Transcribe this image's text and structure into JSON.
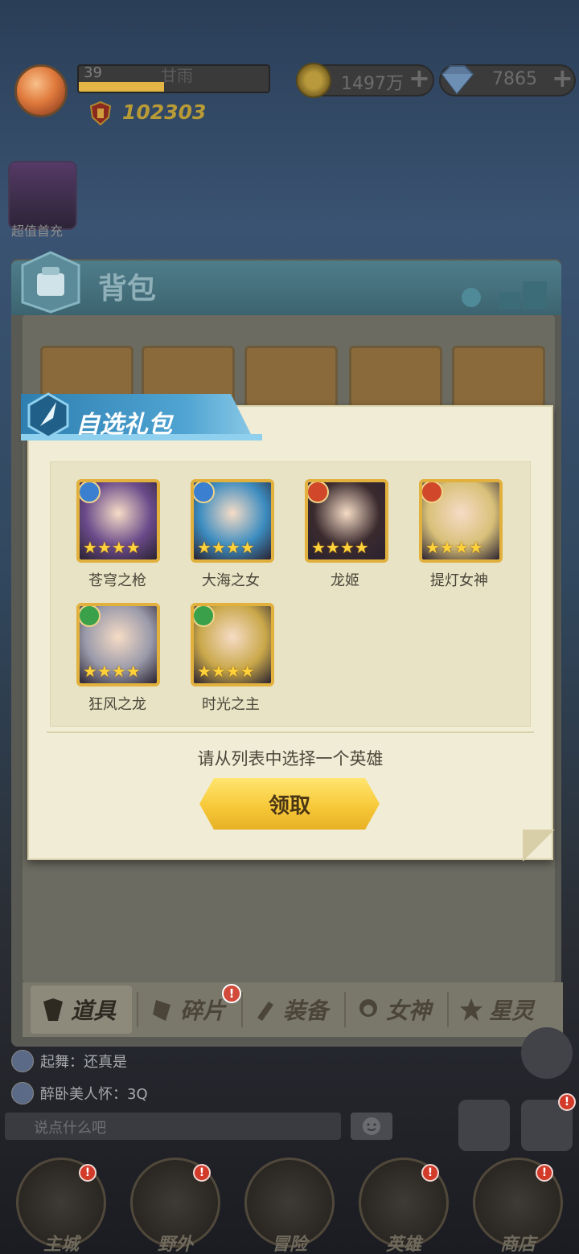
{
  "hud": {
    "level": "39",
    "player_name": "甘雨",
    "level_progress": 0.45,
    "power": "102303",
    "gold": "1497万",
    "gems": "7865",
    "plus": "+",
    "first_pay_label": "超值首充"
  },
  "backpack": {
    "title": "背包",
    "tabs": [
      {
        "label": "道具",
        "icon": "items-icon",
        "badge": ""
      },
      {
        "label": "碎片",
        "icon": "shard-icon",
        "badge": "!"
      },
      {
        "label": "装备",
        "icon": "equipment-icon",
        "badge": ""
      },
      {
        "label": "女神",
        "icon": "goddess-icon",
        "badge": ""
      },
      {
        "label": "星灵",
        "icon": "star-spirit-icon",
        "badge": ""
      }
    ]
  },
  "dialog": {
    "title": "自选礼包",
    "heroes": [
      {
        "name": "苍穹之枪",
        "element": "water",
        "stars": 4,
        "color": "#6a4a8a"
      },
      {
        "name": "大海之女",
        "element": "water",
        "stars": 4,
        "color": "#3c8cc0"
      },
      {
        "name": "龙姬",
        "element": "fire",
        "stars": 4,
        "color": "#3a2a2e"
      },
      {
        "name": "提灯女神",
        "element": "fire",
        "stars": 4,
        "color": "#d8c079"
      },
      {
        "name": "狂风之龙",
        "element": "wind",
        "stars": 4,
        "color": "#9a9aaa"
      },
      {
        "name": "时光之主",
        "element": "wind",
        "stars": 4,
        "color": "#c9a84a"
      }
    ],
    "star_glyph": "★★★★",
    "instruction": "请从列表中选择一个英雄",
    "claim_label": "领取"
  },
  "colors": {
    "water": "#3a7fd0",
    "fire": "#d0472a",
    "wind": "#3aa14a",
    "gold_button": "#f7c93a"
  },
  "chat": {
    "messages": [
      {
        "text": "起舞：还真是"
      },
      {
        "text": "醉卧美人怀：3Q"
      }
    ],
    "placeholder": "说点什么吧"
  },
  "nav": [
    {
      "label": "主城",
      "badge": "!"
    },
    {
      "label": "野外",
      "badge": "!"
    },
    {
      "label": "冒险",
      "badge": ""
    },
    {
      "label": "英雄",
      "badge": "!"
    },
    {
      "label": "商店",
      "badge": "!"
    }
  ],
  "side_badge": "!"
}
